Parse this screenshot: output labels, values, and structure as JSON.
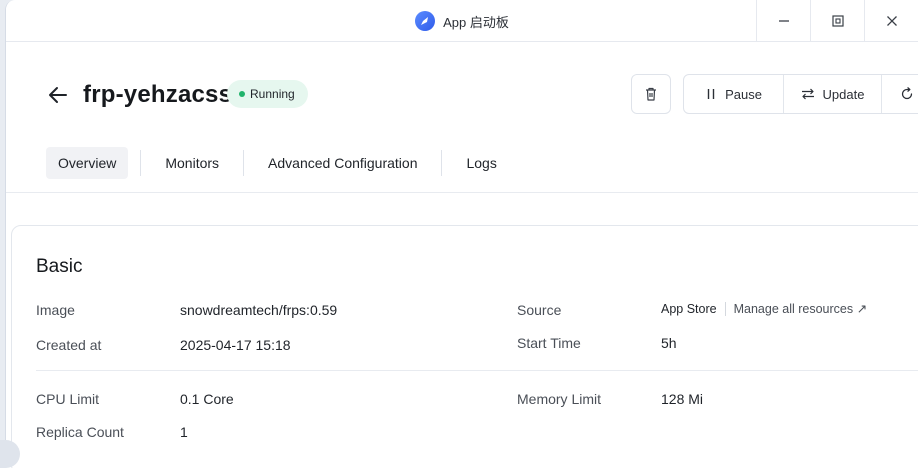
{
  "window": {
    "title": "App 启动板",
    "controls": {
      "minimize": "minimize-icon",
      "restore": "restore-icon",
      "close": "close-icon"
    }
  },
  "header": {
    "app_name": "frp-yehzacss",
    "status": "Running",
    "status_color": "#20b36b",
    "actions": {
      "pause": "Pause",
      "update": "Update"
    }
  },
  "tabs": [
    {
      "label": "Overview",
      "active": true
    },
    {
      "label": "Monitors",
      "active": false
    },
    {
      "label": "Advanced Configuration",
      "active": false
    },
    {
      "label": "Logs",
      "active": false
    }
  ],
  "basic": {
    "title": "Basic",
    "image_label": "Image",
    "image_value": "snowdreamtech/frps:0.59",
    "created_label": "Created at",
    "created_value": "2025-04-17 15:18",
    "source_label": "Source",
    "source_value": "App Store",
    "manage_link": "Manage all resources ↗",
    "start_label": "Start Time",
    "start_value": "5h",
    "cpu_label": "CPU Limit",
    "cpu_value": "0.1 Core",
    "memory_label": "Memory Limit",
    "memory_value": "128 Mi",
    "replica_label": "Replica Count",
    "replica_value": "1"
  }
}
